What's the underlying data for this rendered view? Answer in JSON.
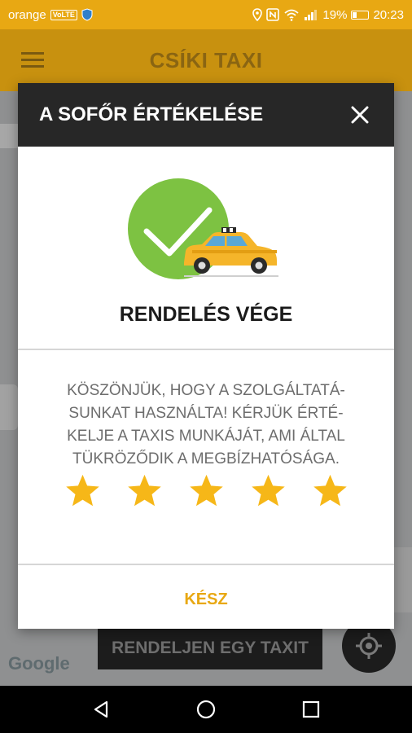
{
  "status_bar": {
    "carrier": "orange",
    "volte": "VoLTE",
    "battery": "19%",
    "time": "20:23"
  },
  "app_bar": {
    "title": "CSÍKI TAXI"
  },
  "map": {
    "order_button": "RENDELJEN EGY TAXIT",
    "google_label": "Google"
  },
  "dialog": {
    "title": "A SOFŐR ÉRTÉKELÉSE",
    "status_title": "RENDELÉS VÉGE",
    "message_lines": [
      "KÖSZÖNJÜK, HOGY A SZOLGÁLTATÁ-",
      "SUNKAT HASZNÁLTA! KÉRJÜK ÉRTÉ-",
      "KELJE A TAXIS MUNKÁJÁT, AMI ÁLTAL",
      "TÜKRÖZŐDIK A MEGBÍZHATÓSÁGA."
    ],
    "rating_max": 5,
    "rating_filled": 5,
    "done_label": "KÉSZ"
  },
  "colors": {
    "accent": "#e8a813",
    "header": "#272727",
    "check_green": "#7dc242"
  }
}
